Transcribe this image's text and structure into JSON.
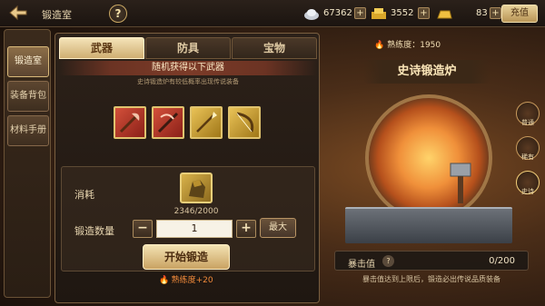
{
  "header": {
    "title": "锻造室",
    "help_label": "?",
    "silver": "67362",
    "gold_ingot": "3552",
    "gold": "83",
    "recharge_label": "充值",
    "plus": "+"
  },
  "sidebar": {
    "items": [
      {
        "label": "锻造室",
        "active": true
      },
      {
        "label": "装备背包",
        "active": false
      },
      {
        "label": "材料手册",
        "active": false
      }
    ]
  },
  "main": {
    "tabs": [
      {
        "label": "武器",
        "active": true
      },
      {
        "label": "防具",
        "active": false
      },
      {
        "label": "宝物",
        "active": false
      }
    ],
    "banner": "随机获得以下武器",
    "subtext": "史诗锻造炉有较低概率出现传说装备",
    "weapons": [
      {
        "icon": "axe-icon",
        "rarity": "red"
      },
      {
        "icon": "crossbow-icon",
        "rarity": "red"
      },
      {
        "icon": "spear-icon",
        "rarity": "gold"
      },
      {
        "icon": "bow-icon",
        "rarity": "gold"
      }
    ],
    "cost_label": "消耗",
    "material_count": "2346/2000",
    "quantity_label": "锻造数量",
    "minus": "−",
    "quantity": "1",
    "plus": "+",
    "max_label": "最大",
    "start_label": "开始锻造",
    "exp_gain": "熟练度+20"
  },
  "forge": {
    "proficiency": "熟练度：1950",
    "title": "史诗锻造炉",
    "side_icons": [
      {
        "label": "普通"
      },
      {
        "label": "稀有"
      },
      {
        "label": "史诗"
      }
    ],
    "crit_label": "暴击值",
    "crit_help": "?",
    "crit_value": "0/200",
    "crit_note": "暴击值达到上限后，锻造必出传说品质装备"
  },
  "colors": {
    "accent_gold": "#cfae72",
    "flame": "#ff6a20",
    "rarity_red": "#c0392b",
    "rarity_gold": "#e0b23a"
  }
}
